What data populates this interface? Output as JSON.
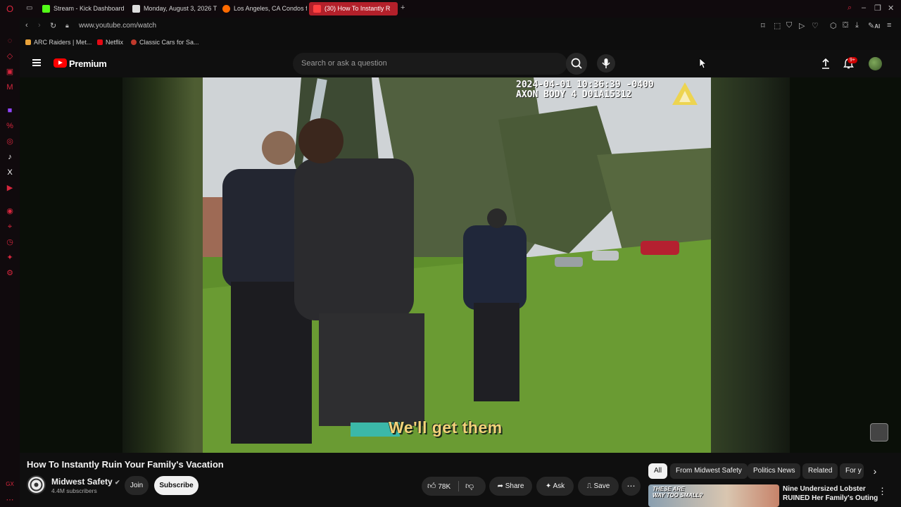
{
  "browser": {
    "tabs": [
      {
        "label": "Stream - Kick Dashboard",
        "favicon_color": "#53fc18"
      },
      {
        "label": "Monday, August 3, 2026 T",
        "favicon_color": "#dddddd"
      },
      {
        "label": "Los Angeles, CA Condos f",
        "favicon_color": "#ff6a00"
      },
      {
        "label": "(30) How To Instantly R",
        "favicon_color": "#ff0000",
        "active": true
      }
    ],
    "new_tab_icon": "plus-icon",
    "url": "www.youtube.com/watch",
    "ai_label": "AI",
    "bookmarks": [
      {
        "label": "ARC Raiders | Met...",
        "color": "#e8a33a"
      },
      {
        "label": "Netflix",
        "color": "#e50914"
      },
      {
        "label": "Classic Cars for Sa...",
        "color": "#c0392b"
      }
    ],
    "accent_color": "#d7263d"
  },
  "youtube": {
    "brand": "Premium",
    "search_placeholder": "Search or ask a question",
    "notification_badge": "9+"
  },
  "video": {
    "timestamp_line1": "2024-04-01 10:36:39 -0400",
    "timestamp_line2": "AXON BODY 4 D01A15312",
    "caption": "We'll get them",
    "title": "How To Instantly Ruin Your Family's Vacation"
  },
  "channel": {
    "name": "Midwest Safety",
    "subscribers": "4.4M subscribers",
    "join_label": "Join",
    "subscribe_label": "Subscribe"
  },
  "actions": {
    "likes": "78K",
    "share_label": "Share",
    "ask_label": "Ask",
    "save_label": "Save"
  },
  "chips": [
    "All",
    "From Midwest Safety",
    "Politics News",
    "Related",
    "For y"
  ],
  "recommendation": {
    "title": "Nine Undersized Lobster RUINED Her Family's Outing",
    "thumb_text_line1": "THESE ARE",
    "thumb_text_line2": "WAY TOO SMALL?"
  }
}
